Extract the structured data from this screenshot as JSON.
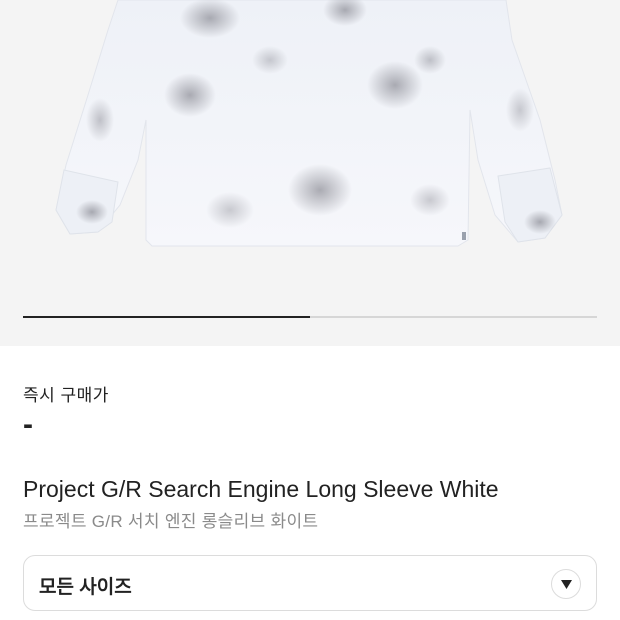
{
  "product_image": {
    "icon": "long-sleeve-shirt-photo"
  },
  "gallery": {
    "progress": 0.5
  },
  "price": {
    "label": "즉시 구매가",
    "value": "-"
  },
  "product": {
    "title": "Project G/R Search Engine Long Sleeve White",
    "subtitle": "프로젝트 G/R 서치 엔진 롱슬리브 화이트"
  },
  "size_select": {
    "label": "모든 사이즈",
    "icon": "chevron-down-icon"
  },
  "colors": {
    "background": "#ffffff",
    "image_background": "#f4f4f4",
    "text": "#222222",
    "subtext": "#8a8a8a"
  }
}
